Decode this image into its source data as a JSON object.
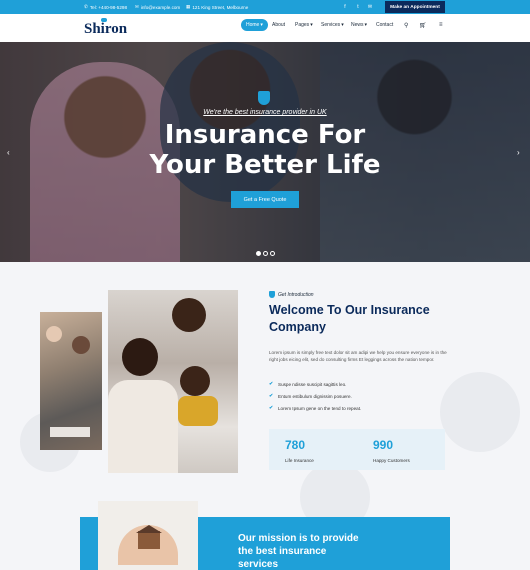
{
  "topbar": {
    "phone": "Tel: +440-98-5298",
    "email": "info@example.com",
    "address": "121 King Street, Melbourne",
    "appointment_label": "Make an Appointment",
    "social": [
      "facebook-icon",
      "twitter-icon",
      "mail-icon"
    ]
  },
  "nav": {
    "logo": "Shiron",
    "items": [
      {
        "label": "Home",
        "active": true,
        "dropdown": true
      },
      {
        "label": "About",
        "active": false,
        "dropdown": false
      },
      {
        "label": "Pages",
        "active": false,
        "dropdown": true
      },
      {
        "label": "Services",
        "active": false,
        "dropdown": true
      },
      {
        "label": "News",
        "active": false,
        "dropdown": true
      },
      {
        "label": "Contact",
        "active": false,
        "dropdown": false
      }
    ],
    "cart_count": "0"
  },
  "hero": {
    "tagline": "We're the best insurance provider in UK",
    "title_line1": "Insurance For",
    "title_line2": "Your Better Life",
    "cta_label": "Get a Free Quote",
    "slide_count": 3,
    "active_slide": 1
  },
  "about": {
    "subtag": "Get Introduction",
    "title_line1": "Welcome To Our Insurance",
    "title_line2": "Company",
    "paragraph": "Lorem ipsum is simply free text dolor sit am adipi we help you ensure everyone is in the right jobs eicing elit, sed do consulting firms Et leggings across the nation tempor.",
    "checks": [
      "Suspe ndisse suscipit sagittis leo.",
      "Entum estibulum dignissim posuere.",
      "Lorem Ipsum gene on the tend to repeat."
    ],
    "stats": [
      {
        "value": "780",
        "label": "Life Insurance"
      },
      {
        "value": "990",
        "label": "Happy Customers"
      }
    ]
  },
  "mission": {
    "line1": "Our mission is to provide",
    "line2": "the best insurance",
    "line3": "services"
  },
  "colors": {
    "accent": "#1fa0d8",
    "navy": "#0b2a5b"
  }
}
